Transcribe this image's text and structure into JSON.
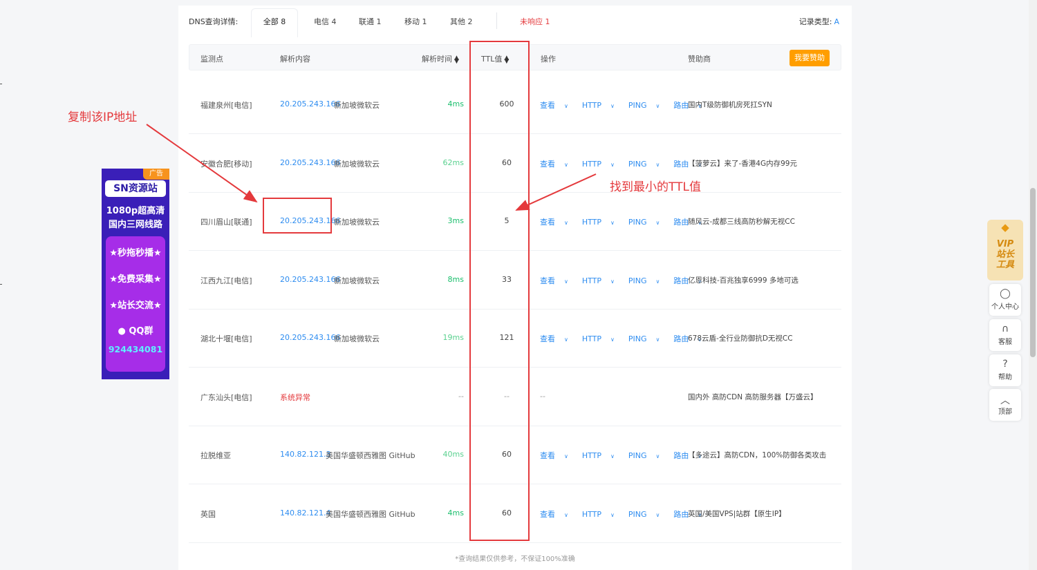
{
  "tabs": {
    "title": "DNS查询详情:",
    "items": [
      "全部 8",
      "电信 4",
      "联通 1",
      "移动 1",
      "其他 2"
    ],
    "failed": "未响应 1",
    "record_type_label": "记录类型:",
    "record_type_value": "A"
  },
  "table": {
    "headers": {
      "location": "监测点",
      "result": "解析内容",
      "time": "解析时间",
      "ttl": "TTL值",
      "ops": "操作",
      "sponsor": "赞助商"
    },
    "sponsor_button": "我要赞助",
    "ops_labels": [
      "查看",
      "HTTP",
      "PING",
      "路由"
    ],
    "rows": [
      {
        "location": "福建泉州[电信]",
        "ip": "20.205.243.166",
        "geo": "新加坡微软云",
        "time": "4ms",
        "ttl": "600",
        "sponsor": "国内T级防御机房死扛SYN"
      },
      {
        "location": "安徽合肥[移动]",
        "ip": "20.205.243.166",
        "geo": "新加坡微软云",
        "time": "62ms",
        "ttl": "60",
        "sponsor": "【菠萝云】来了-香港4G内存99元"
      },
      {
        "location": "四川眉山[联通]",
        "ip": "20.205.243.166",
        "geo": "新加坡微软云",
        "time": "3ms",
        "ttl": "5",
        "sponsor": "随风云-成都三线高防秒解无视CC"
      },
      {
        "location": "江西九江[电信]",
        "ip": "20.205.243.166",
        "geo": "新加坡微软云",
        "time": "8ms",
        "ttl": "33",
        "sponsor": "亿恩科技-百兆独享6999 多地可选"
      },
      {
        "location": "湖北十堰[电信]",
        "ip": "20.205.243.166",
        "geo": "新加坡微软云",
        "time": "19ms",
        "ttl": "121",
        "sponsor": "678云盾-全行业防御抗D无视CC"
      },
      {
        "location": "广东汕头[电信]",
        "error": "系统异常",
        "time": "--",
        "ttl": "--",
        "ops": "--",
        "sponsor": "国内外 高防CDN 高防服务器【万盛云】"
      },
      {
        "location": "拉脱维亚",
        "ip": "140.82.121.3",
        "geo": "美国华盛顿西雅图 GitHub",
        "time": "40ms",
        "ttl": "60",
        "sponsor": "【多途云】高防CDN，100%防御各类攻击"
      },
      {
        "location": "英国",
        "ip": "140.82.121.4",
        "geo": "美国华盛顿西雅图 GitHub",
        "time": "4ms",
        "ttl": "60",
        "sponsor": "英国/美国VPS|站群【原生IP】"
      }
    ],
    "footnote": "*查询结果仅供参考，不保证100%准确"
  },
  "annotations": {
    "copy_ip": "复制该IP地址",
    "find_ttl": "找到最小的TTL值"
  },
  "ad": {
    "badge": "广告",
    "logo": "SN资源站",
    "line1": "1080p超高清",
    "line2": "国内三网线路",
    "items": [
      "★秒拖秒播★",
      "★免费采集★",
      "★站长交流★"
    ],
    "qq": "QQ群",
    "number": "924434081"
  },
  "float": {
    "vip_line1": "VIP",
    "vip_line2": "站长",
    "vip_line3": "工具",
    "buttons": [
      "个人中心",
      "客服",
      "帮助",
      "顶部"
    ]
  },
  "colors": {
    "link": "#2d8cf0",
    "ok": "#19be6b",
    "error": "#e4393c",
    "sponsor": "#ff9e00",
    "ad_bg": "#3a1fb8"
  }
}
